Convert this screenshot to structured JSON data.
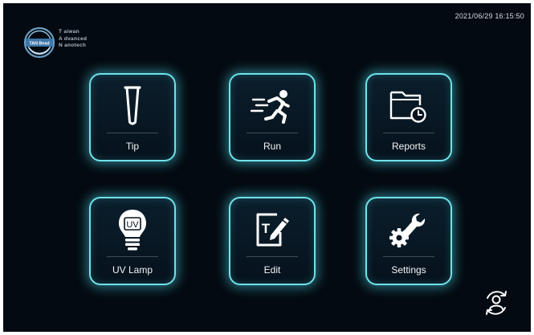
{
  "status": {
    "datetime": "2021/06/29 16:15:50"
  },
  "brand": {
    "badge_text": "TAN Bead",
    "lines": [
      "T aiwan",
      "A dvanced",
      "N anotech"
    ]
  },
  "tiles": [
    {
      "label": "Tip",
      "icon": "tip-icon"
    },
    {
      "label": "Run",
      "icon": "run-icon"
    },
    {
      "label": "Reports",
      "icon": "reports-folder-icon"
    },
    {
      "label": "UV Lamp",
      "icon": "uv-lamp-icon",
      "icon_text": "UV"
    },
    {
      "label": "Edit",
      "icon": "edit-icon",
      "icon_text": "T"
    },
    {
      "label": "Settings",
      "icon": "settings-icon"
    }
  ],
  "colors": {
    "background": "#040a11",
    "accent": "#6fe2ea",
    "text": "#f2f5f7"
  },
  "footer": {
    "icon": "switch-user-icon"
  }
}
